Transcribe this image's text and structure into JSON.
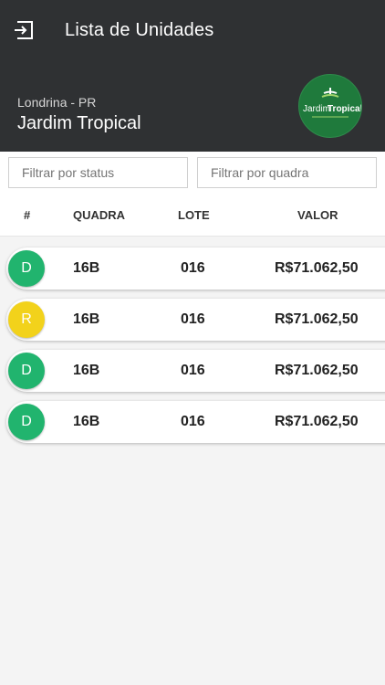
{
  "header": {
    "title": "Lista de Unidades",
    "city": "Londrina - PR",
    "project": "Jardim Tropical",
    "logo_text_a": "Jardim",
    "logo_text_b": "Tropical"
  },
  "filters": {
    "status_placeholder": "Filtrar por status",
    "quadra_placeholder": "Filtrar por quadra"
  },
  "columns": {
    "index": "#",
    "quadra": "QUADRA",
    "lote": "LOTE",
    "valor": "VALOR"
  },
  "units": [
    {
      "status": "D",
      "color": "#21b46e",
      "quadra": "16B",
      "lote": "016",
      "valor": "R$71.062,50"
    },
    {
      "status": "R",
      "color": "#f2d21b",
      "quadra": "16B",
      "lote": "016",
      "valor": "R$71.062,50"
    },
    {
      "status": "D",
      "color": "#21b46e",
      "quadra": "16B",
      "lote": "016",
      "valor": "R$71.062,50"
    },
    {
      "status": "D",
      "color": "#21b46e",
      "quadra": "16B",
      "lote": "016",
      "valor": "R$71.062,50"
    }
  ],
  "colors": {
    "appbar": "#2f3133",
    "available": "#21b46e",
    "reserved": "#f2d21b"
  },
  "icons": {
    "exit": "exit-icon"
  }
}
